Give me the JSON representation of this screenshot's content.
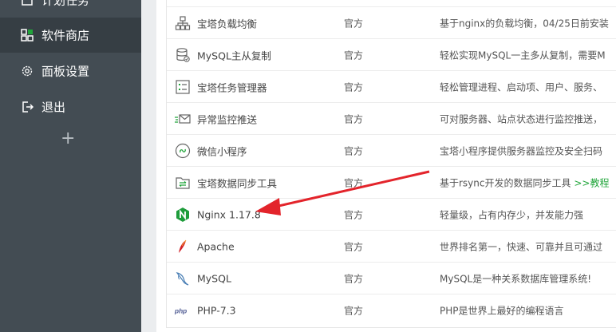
{
  "sidebar": {
    "items": [
      {
        "label": "计划任务",
        "icon": "calendar-icon",
        "active": false
      },
      {
        "label": "软件商店",
        "icon": "apps-grid-icon",
        "active": true
      },
      {
        "label": "面板设置",
        "icon": "gear-icon",
        "active": false
      },
      {
        "label": "退出",
        "icon": "logout-icon",
        "active": false
      }
    ],
    "add_icon": "plus-icon"
  },
  "table": {
    "rows": [
      {
        "name": "宝塔负载均衡",
        "type": "官方",
        "desc": "基于nginx的负载均衡，04/25日前安装",
        "icon": "network-icon"
      },
      {
        "name": "MySQL主从复制",
        "type": "官方",
        "desc": "轻松实现MySQL一主多从复制，需要M",
        "icon": "database-icon"
      },
      {
        "name": "宝塔任务管理器",
        "type": "官方",
        "desc": "轻松管理进程、启动项、用户、服务、",
        "icon": "task-list-icon"
      },
      {
        "name": "异常监控推送",
        "type": "官方",
        "desc": "可对服务器、站点状态进行监控推送，",
        "icon": "mail-send-icon"
      },
      {
        "name": "微信小程序",
        "type": "官方",
        "desc": "宝塔小程序提供服务器监控及安全扫码",
        "icon": "mini-program-icon"
      },
      {
        "name": "宝塔数据同步工具",
        "type": "官方",
        "desc": "基于rsync开发的数据同步工具",
        "desc_link": ">>教程",
        "icon": "folder-sync-icon"
      },
      {
        "name": "Nginx 1.17.8",
        "type": "官方",
        "desc": "轻量级，占有内存少，并发能力强",
        "icon": "nginx-icon"
      },
      {
        "name": "Apache",
        "type": "官方",
        "desc": "世界排名第一，快速、可靠并且可通过",
        "icon": "apache-feather-icon"
      },
      {
        "name": "MySQL",
        "type": "官方",
        "desc": "MySQL是一种关系数据库管理系统!",
        "icon": "mysql-dolphin-icon"
      },
      {
        "name": "PHP-7.3",
        "type": "官方",
        "desc": "PHP是世界上最好的编程语言",
        "icon": "php-icon"
      }
    ]
  },
  "colors": {
    "sidebar_bg": "#434c53",
    "sidebar_active": "#363e44",
    "brand_green": "#20a53a",
    "annotation_red": "#e3242b"
  }
}
